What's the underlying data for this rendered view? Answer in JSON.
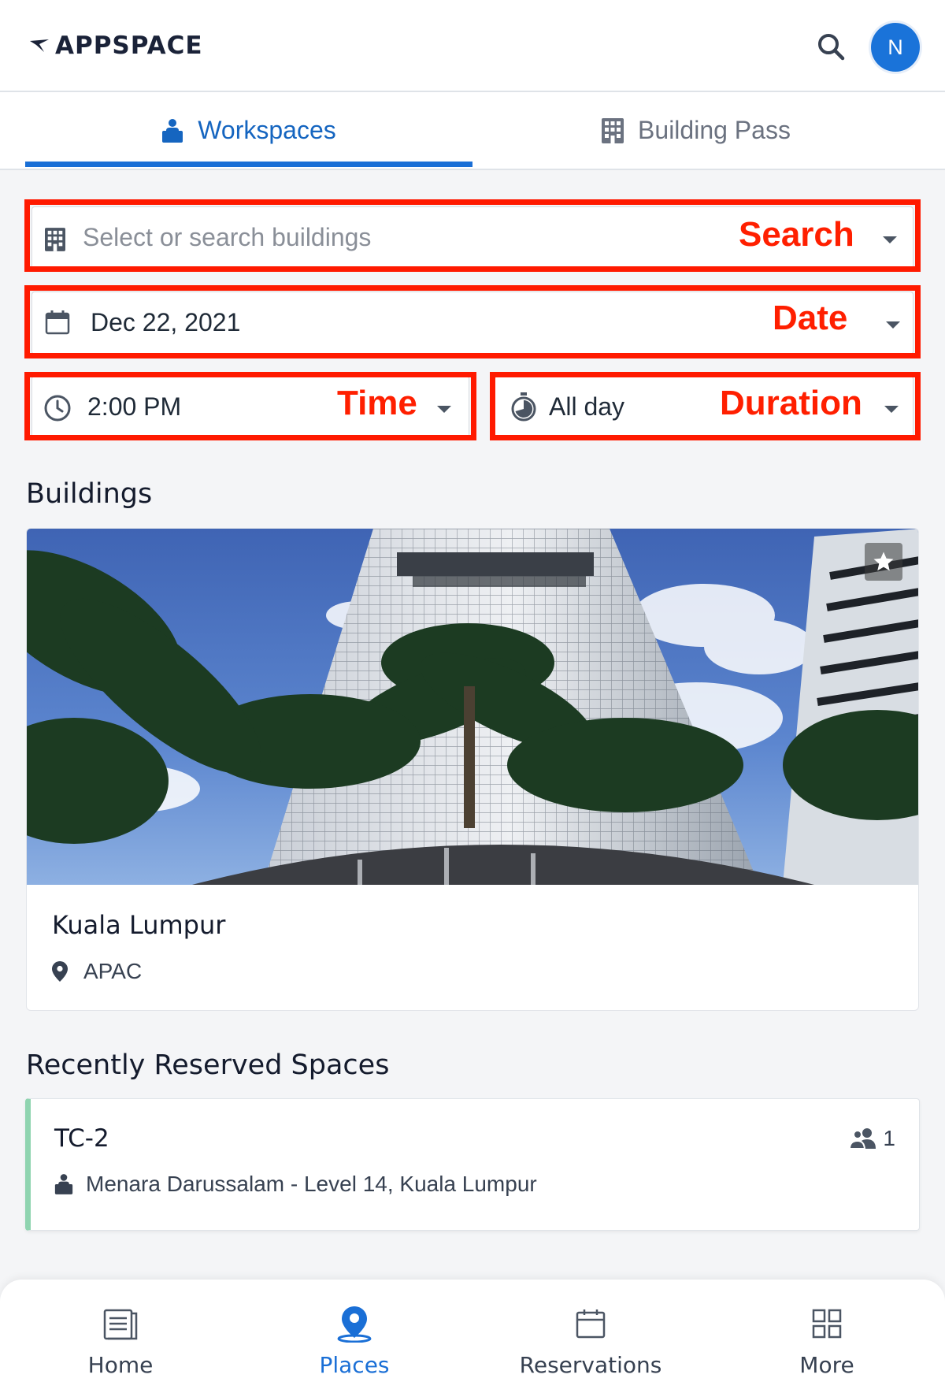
{
  "app": {
    "logo_text": "APPSPACE",
    "avatar_initial": "N"
  },
  "tabs": [
    {
      "label": "Workspaces",
      "active": true,
      "icon": "desk-person-icon"
    },
    {
      "label": "Building Pass",
      "active": false,
      "icon": "building-icon"
    }
  ],
  "filters": {
    "building": {
      "placeholder": "Select or search buildings",
      "annotation": "Search"
    },
    "date": {
      "value": "Dec 22, 2021",
      "annotation": "Date"
    },
    "time": {
      "value": "2:00 PM",
      "annotation": "Time"
    },
    "duration": {
      "value": "All day",
      "annotation": "Duration"
    }
  },
  "buildings": {
    "title": "Buildings",
    "items": [
      {
        "name": "Kuala Lumpur",
        "region": "APAC",
        "favorite": true
      }
    ]
  },
  "recent": {
    "title": "Recently Reserved Spaces",
    "items": [
      {
        "name": "TC-2",
        "location": "Menara Darussalam - Level 14, Kuala Lumpur",
        "capacity": "1"
      }
    ]
  },
  "nav": [
    {
      "label": "Home",
      "icon": "home-icon",
      "active": false
    },
    {
      "label": "Places",
      "icon": "map-pin-icon",
      "active": true
    },
    {
      "label": "Reservations",
      "icon": "calendar-icon",
      "active": false
    },
    {
      "label": "More",
      "icon": "grid-icon",
      "active": false
    }
  ],
  "colors": {
    "accent": "#1a6fd6",
    "annotation": "#ff1a00",
    "space_accent": "#8fd4b0"
  }
}
